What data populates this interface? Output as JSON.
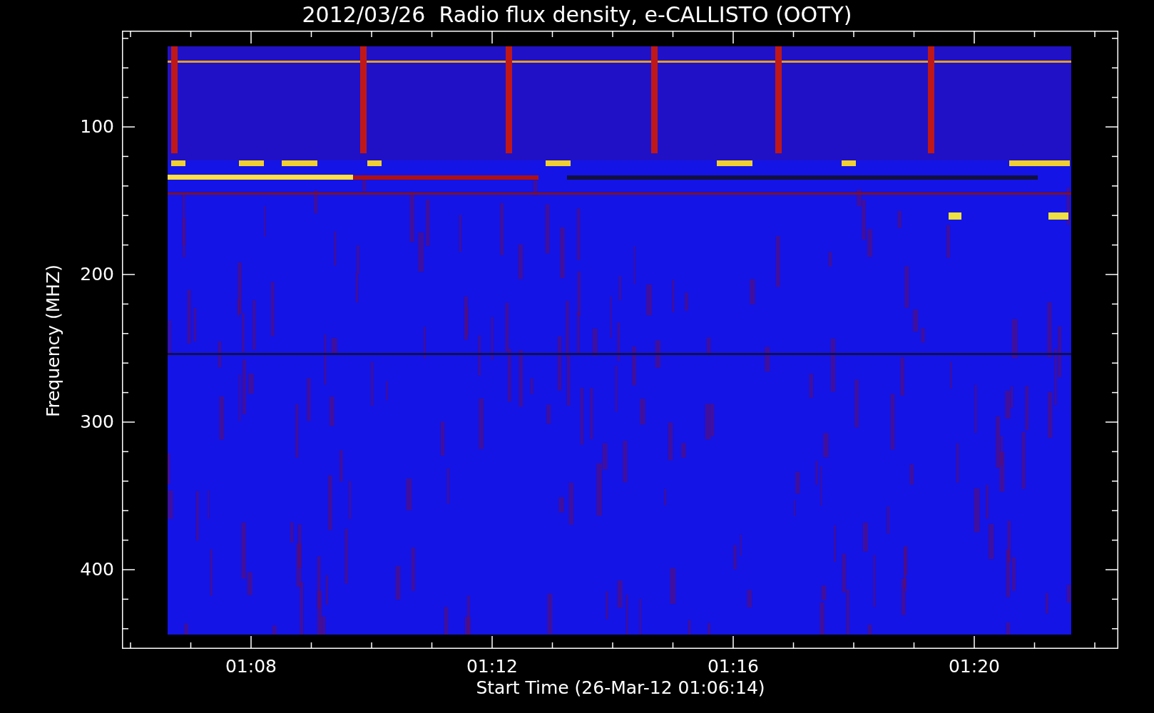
{
  "title": "2012/03/26  Radio flux density, e-CALLISTO (OOTY)",
  "y_axis": {
    "label": "Frequency (MHZ)",
    "ticks": [
      "100",
      "200",
      "300",
      "400"
    ]
  },
  "x_axis": {
    "label": "Start Time (26-Mar-12 01:06:14)",
    "ticks": [
      "01:08",
      "01:12",
      "01:16",
      "01:20"
    ]
  }
}
